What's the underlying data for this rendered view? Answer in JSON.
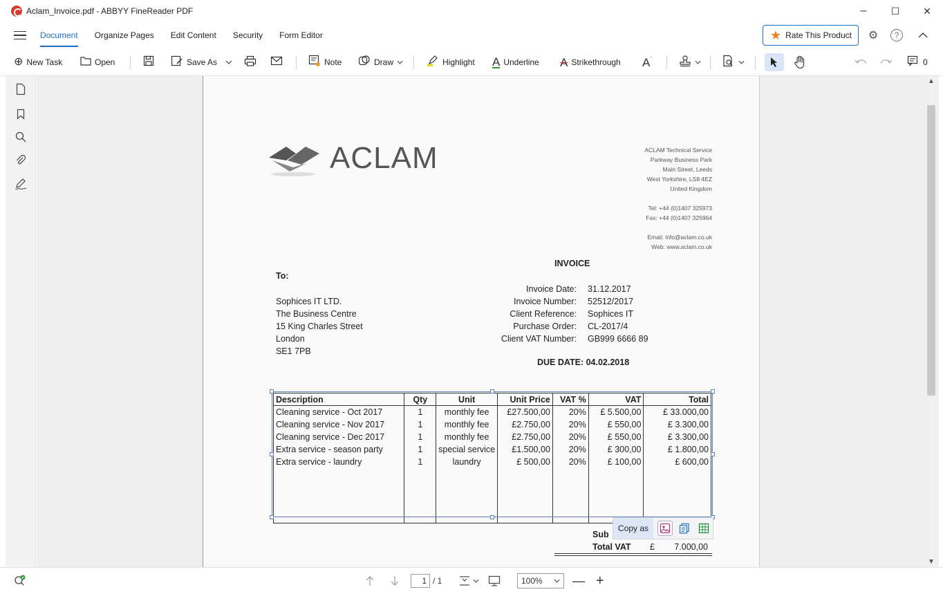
{
  "window": {
    "title": "Aclam_Invoice.pdf - ABBYY FineReader PDF",
    "minimize": "–",
    "maximize": "☐",
    "close": "✕"
  },
  "tabs": [
    {
      "label": "Document"
    },
    {
      "label": "Organize Pages"
    },
    {
      "label": "Edit Content"
    },
    {
      "label": "Security"
    },
    {
      "label": "Form Editor"
    }
  ],
  "rate_button": "Rate This Product",
  "toolbar": {
    "new_task": "New Task",
    "open": "Open",
    "save_as": "Save As",
    "note": "Note",
    "draw": "Draw",
    "highlight": "Highlight",
    "underline": "Underline",
    "strikethrough": "Strikethrough",
    "comments_count": "0"
  },
  "statusbar": {
    "page_current": "1",
    "page_total": "/ 1",
    "zoom": "100%"
  },
  "document": {
    "company_name": "ACLAM",
    "address_lines": [
      "ACLAM Technical Service",
      "Parkway Business Park",
      "Main Street, Leeds",
      "West Yorkshire, LS8 4EZ",
      "United Kingdom",
      "Tel: +44 (0)1407 325973",
      "Fax: +44 (0)1407 325964",
      "Email: info@aclam.co.uk",
      "Web: www.aclam.co.uk"
    ],
    "invoice_title": "INVOICE",
    "to_label": "To:",
    "to_lines": [
      "Sophices IT LTD.",
      "The Business Centre",
      "15 King Charles Street",
      "London",
      "SE1 7PB"
    ],
    "meta": [
      {
        "k": "Invoice Date:",
        "v": "31.12.2017"
      },
      {
        "k": "Invoice Number:",
        "v": "52512/2017"
      },
      {
        "k": "Client Reference:",
        "v": "Sophices IT"
      },
      {
        "k": "Purchase Order:",
        "v": "CL-2017/4"
      },
      {
        "k": "Client VAT Number:",
        "v": "GB999 6666 89"
      }
    ],
    "due_date": "DUE DATE: 04.02.2018",
    "table": {
      "headers": [
        "Description",
        "Qty",
        "Unit",
        "Unit Price",
        "VAT %",
        "VAT",
        "Total"
      ],
      "rows": [
        [
          "Cleaning service - Oct 2017",
          "1",
          "monthly fee",
          "£27.500,00",
          "20%",
          "£ 5.500,00",
          "£    33.000,00"
        ],
        [
          "Cleaning service - Nov 2017",
          "1",
          "monthly fee",
          "£2.750,00",
          "20%",
          "£    550,00",
          "£      3.300,00"
        ],
        [
          "Cleaning service - Dec 2017",
          "1",
          "monthly fee",
          "£2.750,00",
          "20%",
          "£    550,00",
          "£      3.300,00"
        ],
        [
          "Extra service - season party",
          "1",
          "special service",
          "£1.500,00",
          "20%",
          "£    300,00",
          "£      1.800,00"
        ],
        [
          "Extra service - laundry",
          "1",
          "laundry",
          "£    500,00",
          "20%",
          "£    100,00",
          "£         600,00"
        ]
      ]
    },
    "copy_as": "Copy as",
    "sub_label": "Sub",
    "total_vat_label": "Total VAT",
    "total_vat_currency": "£",
    "total_vat_value": "7.000,00"
  }
}
